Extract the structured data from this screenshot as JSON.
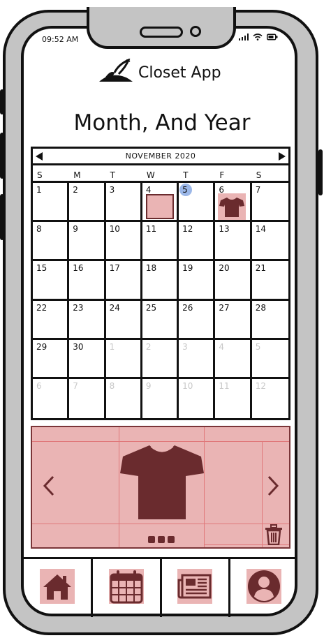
{
  "status_bar": {
    "time": "09:52 AM"
  },
  "header": {
    "app_name": "Closet App",
    "page_title": "Month, And Year"
  },
  "calendar": {
    "month_label": "NOVEMBER 2020",
    "weekdays": [
      "S",
      "M",
      "T",
      "W",
      "T",
      "F",
      "S"
    ],
    "days": [
      [
        "1",
        "2",
        "3",
        "4",
        "5",
        "6",
        "7"
      ],
      [
        "8",
        "9",
        "10",
        "11",
        "12",
        "13",
        "14"
      ],
      [
        "15",
        "16",
        "17",
        "18",
        "19",
        "20",
        "21"
      ],
      [
        "22",
        "23",
        "24",
        "25",
        "26",
        "27",
        "28"
      ],
      [
        "29",
        "30",
        "1",
        "2",
        "3",
        "4",
        "5"
      ],
      [
        "6",
        "7",
        "8",
        "9",
        "10",
        "11",
        "12"
      ]
    ],
    "today": "5"
  },
  "colors": {
    "accent_fill": "#eab4b4",
    "accent_dark": "#6a2b2e",
    "today_dot": "#9bb7e8",
    "frame_gray": "#c4c4c4"
  },
  "carousel": {
    "item_icon": "tshirt-icon",
    "page_indicator_count": 3
  },
  "nav": {
    "items": [
      "home-icon",
      "calendar-icon",
      "news-icon",
      "profile-icon"
    ]
  }
}
